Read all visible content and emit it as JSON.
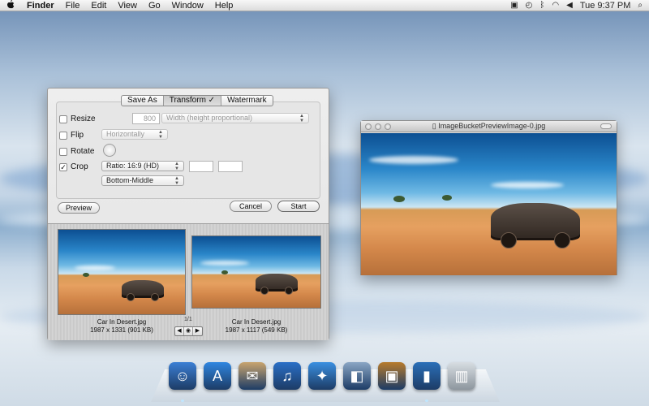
{
  "menubar": {
    "app": "Finder",
    "items": [
      "File",
      "Edit",
      "View",
      "Go",
      "Window",
      "Help"
    ],
    "clock": "Tue 9:37 PM",
    "status_icons": [
      "user-icon",
      "time-machine-icon",
      "bluetooth-icon",
      "wifi-icon",
      "volume-icon",
      "spotlight-icon"
    ]
  },
  "panel": {
    "tabs": [
      {
        "label": "Save As",
        "active": false
      },
      {
        "label": "Transform ✓",
        "active": true
      },
      {
        "label": "Watermark",
        "active": false
      }
    ],
    "resize": {
      "label": "Resize",
      "checked": false,
      "value": "800",
      "mode": "Width (height proportional)"
    },
    "flip": {
      "label": "Flip",
      "checked": false,
      "mode": "Horizontally"
    },
    "rotate": {
      "label": "Rotate",
      "checked": false
    },
    "crop": {
      "label": "Crop",
      "checked": true,
      "check_mark": "✓",
      "ratio": "Ratio: 16:9 (HD)",
      "position": "Bottom-Middle"
    },
    "buttons": {
      "preview": "Preview",
      "cancel": "Cancel",
      "start": "Start"
    },
    "source": {
      "name": "Car In Desert.jpg",
      "info": "1987 x 1331 (901 KB)"
    },
    "result": {
      "name": "Car In Desert.jpg",
      "info": "1987 x 1117 (549 KB)"
    },
    "page": "1/1",
    "pager": {
      "prev": "◀",
      "next": "▶"
    }
  },
  "preview_window": {
    "title": "ImageBucketPreviewImage-0.jpg"
  },
  "dock": {
    "icons": [
      {
        "name": "finder-icon",
        "glyph": "☺",
        "color": "#3b7fd4"
      },
      {
        "name": "app-store-icon",
        "glyph": "A",
        "color": "#2f86e0"
      },
      {
        "name": "mail-icon",
        "glyph": "✉",
        "color": "#c9a46e"
      },
      {
        "name": "itunes-icon",
        "glyph": "♫",
        "color": "#2a6fc6"
      },
      {
        "name": "safari-icon",
        "glyph": "✦",
        "color": "#3a8fe0"
      },
      {
        "name": "preview-icon",
        "glyph": "◧",
        "color": "#8aa6c4"
      },
      {
        "name": "iphoto-icon",
        "glyph": "▣",
        "color": "#b77b2c"
      },
      {
        "name": "image-bucket-icon",
        "glyph": "▮",
        "color": "#2a6fb8"
      },
      {
        "name": "trash-icon",
        "glyph": "▥",
        "color": "#9aa3ab"
      }
    ]
  }
}
